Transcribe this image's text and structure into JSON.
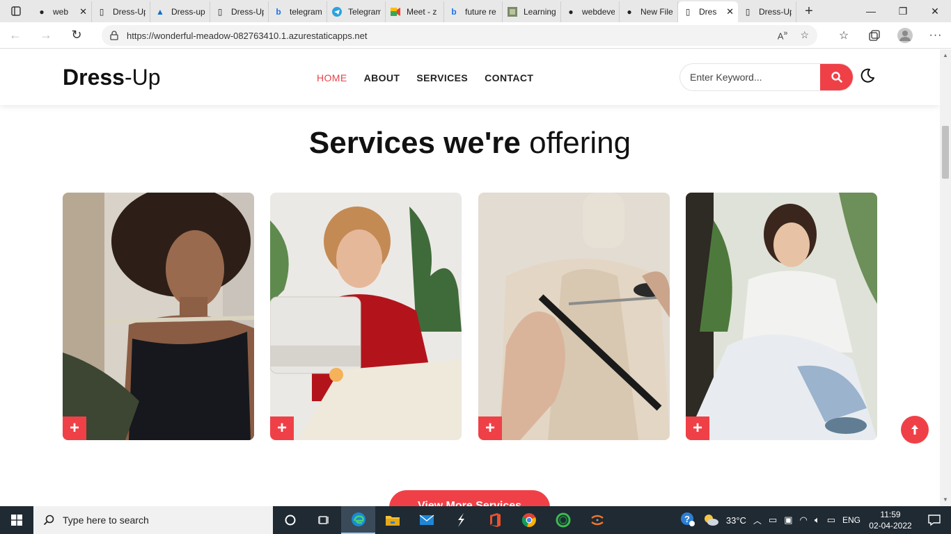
{
  "browser": {
    "tabs": [
      {
        "label": "web",
        "icon": "github-icon"
      },
      {
        "label": "Dress-Up",
        "icon": "page-icon"
      },
      {
        "label": "Dress-up",
        "icon": "azure-icon"
      },
      {
        "label": "Dress-Up",
        "icon": "page-icon"
      },
      {
        "label": "telegram",
        "icon": "bing-icon"
      },
      {
        "label": "Telegram",
        "icon": "telegram-icon"
      },
      {
        "label": "Meet - z",
        "icon": "meet-icon"
      },
      {
        "label": "future re",
        "icon": "bing-icon"
      },
      {
        "label": "Learning",
        "icon": "image-icon"
      },
      {
        "label": "webdeve",
        "icon": "github-icon"
      },
      {
        "label": "New File",
        "icon": "github-icon"
      },
      {
        "label": "Dres",
        "icon": "page-icon",
        "active": true
      },
      {
        "label": "Dress-Up",
        "icon": "page-icon"
      }
    ],
    "url": "https://wonderful-meadow-082763410.1.azurestaticapps.net"
  },
  "site": {
    "logo_bold": "Dress",
    "logo_light": "-Up",
    "nav": [
      "HOME",
      "ABOUT",
      "SERVICES",
      "CONTACT"
    ],
    "search_placeholder": "Enter Keyword...",
    "heading_bold": "Services we're",
    "heading_light": "offering",
    "cards": [
      {
        "subject": "model being measured with tape",
        "plus": "+"
      },
      {
        "subject": "woman at sewing machine",
        "plus": "+"
      },
      {
        "subject": "scissors cutting fabric on mannequin",
        "plus": "+"
      },
      {
        "subject": "woman hand-sewing garment",
        "plus": "+"
      }
    ],
    "view_more": "View More Services"
  },
  "taskbar": {
    "search_placeholder": "Type here to search",
    "weather": "33°C",
    "language": "ENG",
    "time": "11:59",
    "date": "02-04-2022"
  },
  "colors": {
    "accent": "#f04047",
    "taskbar": "#1f2a33"
  }
}
